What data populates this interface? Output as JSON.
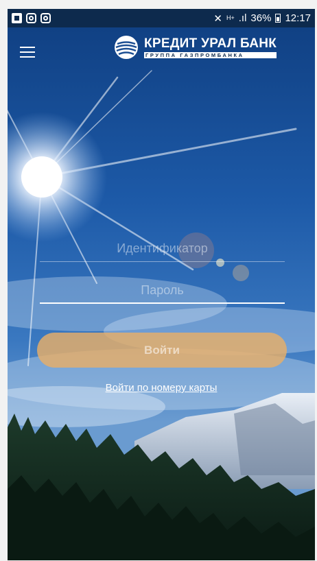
{
  "status_bar": {
    "notifications": [
      "flipboard-icon",
      "instagram-icon",
      "instagram-icon"
    ],
    "network_label": "H+",
    "battery": "36%",
    "time": "12:17"
  },
  "header": {
    "bank_name": "КРЕДИТ УРАЛ БАНК",
    "bank_group": "ГРУППА ГАЗПРОМБАНКА"
  },
  "login_form": {
    "login_placeholder": "Идентификатор",
    "login_value": "",
    "password_placeholder": "Пароль",
    "password_value": "",
    "submit_label": "Войти",
    "card_login_link": "Войти по номеру карты"
  },
  "colors": {
    "status_bar": "#0d2a4d",
    "submit_button": "#e8af68",
    "sky": "#1f5fae"
  }
}
